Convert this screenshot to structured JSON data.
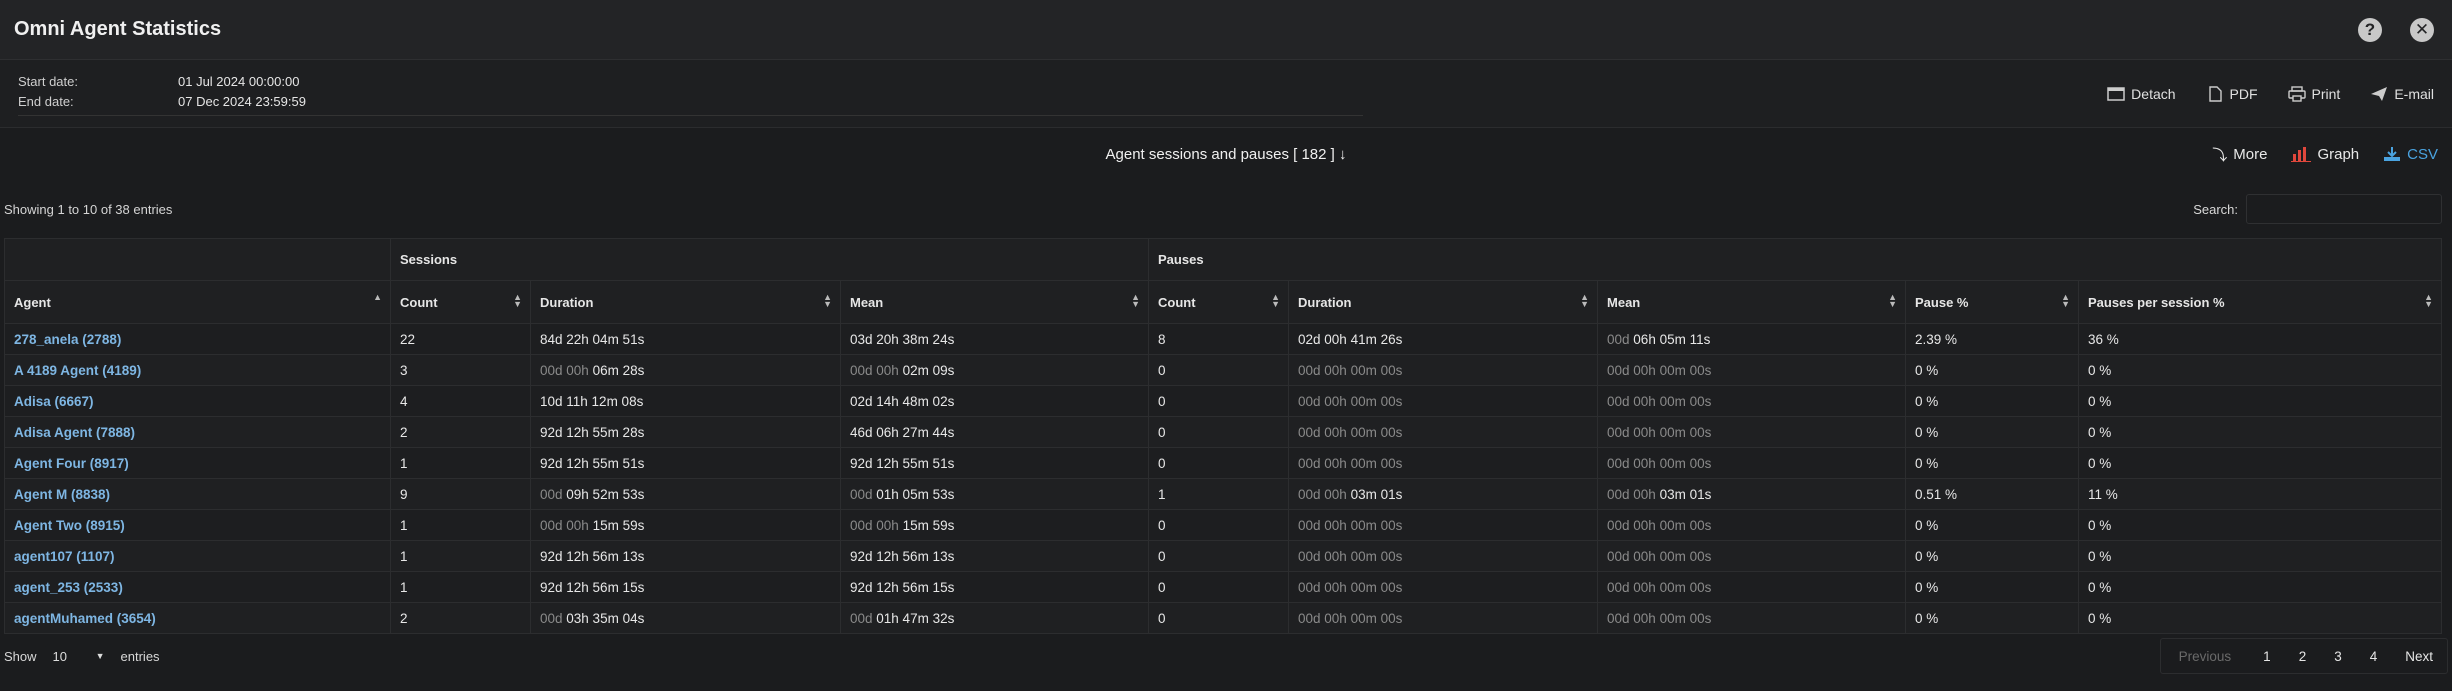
{
  "app": {
    "title": "Omni Agent Statistics"
  },
  "dates": {
    "start_label": "Start date:",
    "start_value": "01 Jul 2024 00:00:00",
    "end_label": "End date:",
    "end_value": "07 Dec 2024 23:59:59"
  },
  "actions": {
    "detach": "Detach",
    "pdf": "PDF",
    "print": "Print",
    "email": "E-mail"
  },
  "report": {
    "title": "Agent sessions and pauses [ 182 ]",
    "more": "More",
    "graph": "Graph",
    "csv": "CSV"
  },
  "table_info": {
    "showing": "Showing 1 to 10 of 38 entries",
    "search_label": "Search:"
  },
  "table": {
    "group_headers": {
      "sessions": "Sessions",
      "pauses": "Pauses"
    },
    "columns": [
      "Agent",
      "Count",
      "Duration",
      "Mean",
      "Count",
      "Duration",
      "Mean",
      "Pause %",
      "Pauses per session %"
    ],
    "rows": [
      {
        "agent": "278_anela (2788)",
        "s_count": "22",
        "s_dur": [
          "",
          "84d 22h 04m 51s"
        ],
        "s_mean": [
          "",
          "03d 20h 38m 24s"
        ],
        "p_count": "8",
        "p_dur": [
          "",
          "02d 00h 41m 26s"
        ],
        "p_mean": [
          "00d ",
          "06h 05m 11s"
        ],
        "pause_pct": "2.39 %",
        "pps": "36 %"
      },
      {
        "agent": "A 4189 Agent (4189)",
        "s_count": "3",
        "s_dur": [
          "00d 00h ",
          "06m 28s"
        ],
        "s_mean": [
          "00d 00h ",
          "02m 09s"
        ],
        "p_count": "0",
        "p_dur": [
          "00d 00h 00m 00s",
          ""
        ],
        "p_mean": [
          "00d 00h 00m 00s",
          ""
        ],
        "pause_pct": "0 %",
        "pps": "0 %"
      },
      {
        "agent": "Adisa (6667)",
        "s_count": "4",
        "s_dur": [
          "",
          "10d 11h 12m 08s"
        ],
        "s_mean": [
          "",
          "02d 14h 48m 02s"
        ],
        "p_count": "0",
        "p_dur": [
          "00d 00h 00m 00s",
          ""
        ],
        "p_mean": [
          "00d 00h 00m 00s",
          ""
        ],
        "pause_pct": "0 %",
        "pps": "0 %"
      },
      {
        "agent": "Adisa Agent (7888)",
        "s_count": "2",
        "s_dur": [
          "",
          "92d 12h 55m 28s"
        ],
        "s_mean": [
          "",
          "46d 06h 27m 44s"
        ],
        "p_count": "0",
        "p_dur": [
          "00d 00h 00m 00s",
          ""
        ],
        "p_mean": [
          "00d 00h 00m 00s",
          ""
        ],
        "pause_pct": "0 %",
        "pps": "0 %"
      },
      {
        "agent": "Agent Four (8917)",
        "s_count": "1",
        "s_dur": [
          "",
          "92d 12h 55m 51s"
        ],
        "s_mean": [
          "",
          "92d 12h 55m 51s"
        ],
        "p_count": "0",
        "p_dur": [
          "00d 00h 00m 00s",
          ""
        ],
        "p_mean": [
          "00d 00h 00m 00s",
          ""
        ],
        "pause_pct": "0 %",
        "pps": "0 %"
      },
      {
        "agent": "Agent M (8838)",
        "s_count": "9",
        "s_dur": [
          "00d ",
          "09h 52m 53s"
        ],
        "s_mean": [
          "00d ",
          "01h 05m 53s"
        ],
        "p_count": "1",
        "p_dur": [
          "00d 00h ",
          "03m 01s"
        ],
        "p_mean": [
          "00d 00h ",
          "03m 01s"
        ],
        "pause_pct": "0.51 %",
        "pps": "11 %"
      },
      {
        "agent": "Agent Two (8915)",
        "s_count": "1",
        "s_dur": [
          "00d 00h ",
          "15m 59s"
        ],
        "s_mean": [
          "00d 00h ",
          "15m 59s"
        ],
        "p_count": "0",
        "p_dur": [
          "00d 00h 00m 00s",
          ""
        ],
        "p_mean": [
          "00d 00h 00m 00s",
          ""
        ],
        "pause_pct": "0 %",
        "pps": "0 %"
      },
      {
        "agent": "agent107 (1107)",
        "s_count": "1",
        "s_dur": [
          "",
          "92d 12h 56m 13s"
        ],
        "s_mean": [
          "",
          "92d 12h 56m 13s"
        ],
        "p_count": "0",
        "p_dur": [
          "00d 00h 00m 00s",
          ""
        ],
        "p_mean": [
          "00d 00h 00m 00s",
          ""
        ],
        "pause_pct": "0 %",
        "pps": "0 %"
      },
      {
        "agent": "agent_253 (2533)",
        "s_count": "1",
        "s_dur": [
          "",
          "92d 12h 56m 15s"
        ],
        "s_mean": [
          "",
          "92d 12h 56m 15s"
        ],
        "p_count": "0",
        "p_dur": [
          "00d 00h 00m 00s",
          ""
        ],
        "p_mean": [
          "00d 00h 00m 00s",
          ""
        ],
        "pause_pct": "0 %",
        "pps": "0 %"
      },
      {
        "agent": "agentMuhamed (3654)",
        "s_count": "2",
        "s_dur": [
          "00d ",
          "03h 35m 04s"
        ],
        "s_mean": [
          "00d ",
          "01h 47m 32s"
        ],
        "p_count": "0",
        "p_dur": [
          "00d 00h 00m 00s",
          ""
        ],
        "p_mean": [
          "00d 00h 00m 00s",
          ""
        ],
        "pause_pct": "0 %",
        "pps": "0 %"
      }
    ]
  },
  "footer": {
    "show_label": "Show",
    "show_value": "10",
    "entries_label": "entries",
    "pager": [
      "Previous",
      "1",
      "2",
      "3",
      "4",
      "Next"
    ]
  },
  "colors": {
    "link": "#7eb6e3",
    "csv": "#4aa3e0",
    "graph_icon": "#e0473c"
  }
}
